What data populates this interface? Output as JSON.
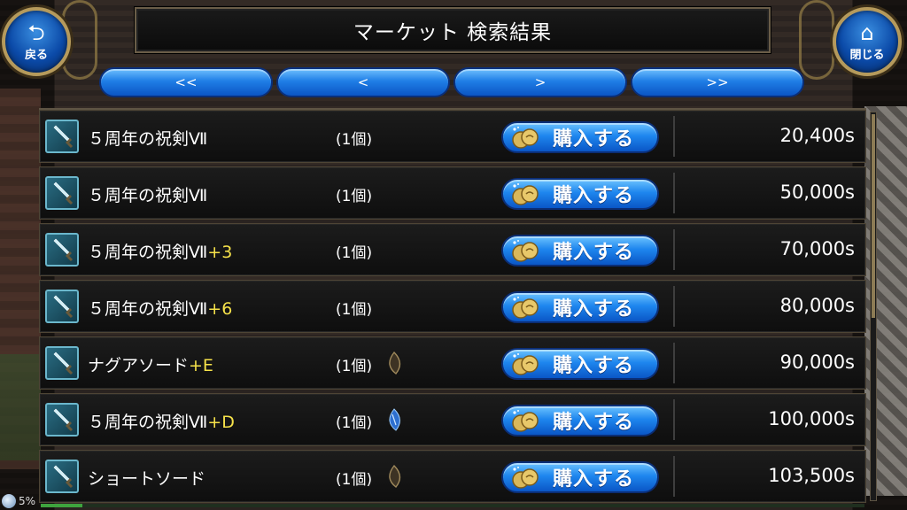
{
  "header": {
    "title": "マーケット 検索結果",
    "back_label": "戻る",
    "close_label": "閉じる"
  },
  "pager": {
    "first": "<<",
    "prev": "<",
    "next": ">",
    "last": ">>"
  },
  "buy_label": "購入する",
  "items": [
    {
      "name": "５周年の祝剣Ⅶ",
      "plus": "",
      "qty": "(1個)",
      "stone": "",
      "price": "20,400s"
    },
    {
      "name": "５周年の祝剣Ⅶ",
      "plus": "",
      "qty": "(1個)",
      "stone": "",
      "price": "50,000s"
    },
    {
      "name": "５周年の祝剣Ⅶ",
      "plus": "+3",
      "qty": "(1個)",
      "stone": "",
      "price": "70,000s"
    },
    {
      "name": "５周年の祝剣Ⅶ",
      "plus": "+6",
      "qty": "(1個)",
      "stone": "",
      "price": "80,000s"
    },
    {
      "name": "ナグアソード",
      "plus": "+E",
      "qty": "(1個)",
      "stone": "brown",
      "price": "90,000s"
    },
    {
      "name": "５周年の祝剣Ⅶ",
      "plus": "+D",
      "qty": "(1個)",
      "stone": "blue",
      "price": "100,000s"
    },
    {
      "name": "ショートソード",
      "plus": "",
      "qty": "(1個)",
      "stone": "brown",
      "price": "103,500s"
    }
  ],
  "status": {
    "percent_text": "5%",
    "progress": 0.05
  },
  "colors": {
    "accent_blue": "#1e86ee",
    "plus_yellow": "#f6e24a",
    "frame_gold": "#b59a5c"
  }
}
